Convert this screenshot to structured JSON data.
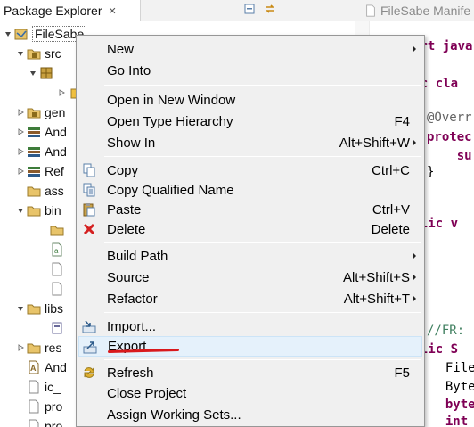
{
  "explorer": {
    "tab_title": "Package Explorer",
    "tab_close": "✕",
    "tree": [
      {
        "label": "FileSabe",
        "icon": "project-icon"
      },
      {
        "label": "src",
        "icon": "source-folder-icon"
      },
      {
        "label": "",
        "icon": "package-icon"
      },
      {
        "label": "",
        "icon": "java-file-icon"
      },
      {
        "label": "gen",
        "icon": "source-folder-icon"
      },
      {
        "label": "And",
        "icon": "library-icon"
      },
      {
        "label": "And",
        "icon": "library-icon"
      },
      {
        "label": "Ref",
        "icon": "library-icon"
      },
      {
        "label": "ass",
        "icon": "folder-icon"
      },
      {
        "label": "bin",
        "icon": "folder-icon"
      },
      {
        "label": "",
        "icon": "folder-icon"
      },
      {
        "label": "",
        "icon": "file-icon"
      },
      {
        "label": "",
        "icon": "file-icon"
      },
      {
        "label": "",
        "icon": "file-icon"
      },
      {
        "label": "libs",
        "icon": "folder-icon"
      },
      {
        "label": "",
        "icon": "jar-icon"
      },
      {
        "label": "res",
        "icon": "folder-icon"
      },
      {
        "label": "And",
        "icon": "manifest-icon"
      },
      {
        "label": "ic_",
        "icon": "file-icon"
      },
      {
        "label": "pro",
        "icon": "file-icon"
      },
      {
        "label": "pro",
        "icon": "file-icon"
      }
    ]
  },
  "editor": {
    "tab_title": "FileSabe Manife",
    "lines": [
      {
        "text": "ort java",
        "cls": "kw"
      },
      {
        "text": "lic cla",
        "cls": "kw"
      },
      {
        "text": "@Overr",
        "cls": "ann"
      },
      {
        "text": "protec",
        "cls": "kw"
      },
      {
        "text": "    su",
        "cls": "kw"
      },
      {
        "text": "}",
        "cls": "txt"
      },
      {
        "text": "ublic v",
        "cls": "kw"
      },
      {
        "text": "//FR:",
        "cls": "cmt"
      },
      {
        "text": "ublic S",
        "cls": "kw"
      },
      {
        "text": "  File",
        "cls": "txt"
      },
      {
        "text": "  Byte",
        "cls": "txt"
      },
      {
        "text": "  byte",
        "cls": "kw"
      },
      {
        "text": "  int",
        "cls": "kw"
      }
    ]
  },
  "context_menu": {
    "items": [
      {
        "label": "New",
        "shortcut": "",
        "submenu": true,
        "icon": ""
      },
      {
        "label": "Go Into",
        "shortcut": "",
        "submenu": false,
        "icon": ""
      },
      {
        "label": "Open in New Window",
        "shortcut": "",
        "submenu": false,
        "icon": ""
      },
      {
        "label": "Open Type Hierarchy",
        "shortcut": "F4",
        "submenu": false,
        "icon": ""
      },
      {
        "label": "Show In",
        "shortcut": "Alt+Shift+W",
        "submenu": true,
        "icon": ""
      },
      {
        "label": "Copy",
        "shortcut": "Ctrl+C",
        "submenu": false,
        "icon": "copy-icon"
      },
      {
        "label": "Copy Qualified Name",
        "shortcut": "",
        "submenu": false,
        "icon": "copy-qualified-icon"
      },
      {
        "label": "Paste",
        "shortcut": "Ctrl+V",
        "submenu": false,
        "icon": "paste-icon"
      },
      {
        "label": "Delete",
        "shortcut": "Delete",
        "submenu": false,
        "icon": "delete-icon"
      },
      {
        "label": "Build Path",
        "shortcut": "",
        "submenu": true,
        "icon": ""
      },
      {
        "label": "Source",
        "shortcut": "Alt+Shift+S",
        "submenu": true,
        "icon": ""
      },
      {
        "label": "Refactor",
        "shortcut": "Alt+Shift+T",
        "submenu": true,
        "icon": ""
      },
      {
        "label": "Import...",
        "shortcut": "",
        "submenu": false,
        "icon": "import-icon"
      },
      {
        "label": "Export...",
        "shortcut": "",
        "submenu": false,
        "icon": "export-icon"
      },
      {
        "label": "Refresh",
        "shortcut": "F5",
        "submenu": false,
        "icon": "refresh-icon"
      },
      {
        "label": "Close Project",
        "shortcut": "",
        "submenu": false,
        "icon": ""
      },
      {
        "label": "Assign Working Sets...",
        "shortcut": "",
        "submenu": false,
        "icon": ""
      }
    ]
  },
  "colors": {
    "menu_bg": "#f0f0f0",
    "highlight": "#e5f1fb",
    "annotation_red": "#d9191c",
    "keyword": "#7f0055"
  }
}
